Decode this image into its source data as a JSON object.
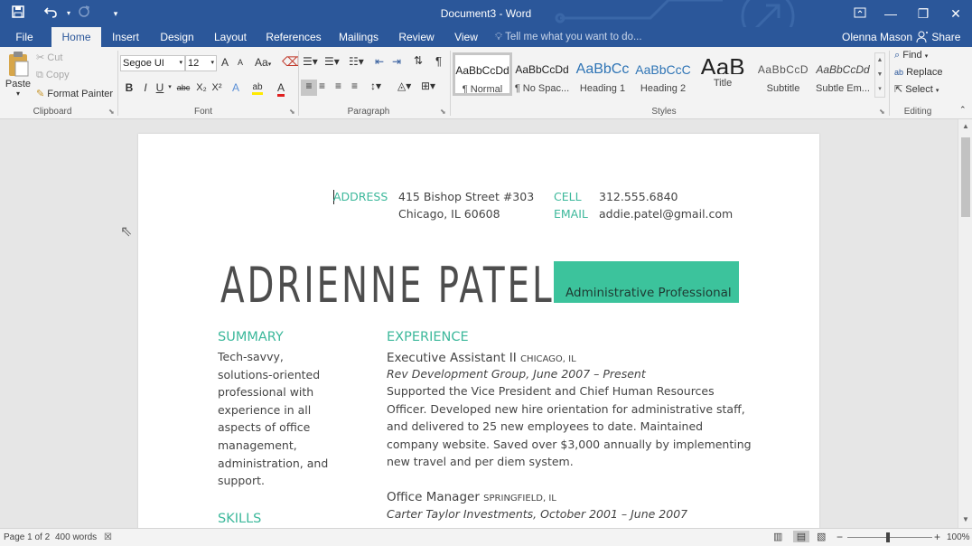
{
  "titlebar": {
    "title": "Document3 - Word",
    "save_icon": "save-icon",
    "undo_icon": "undo-icon",
    "redo_icon": "redo-icon",
    "customize_icon": "customize-qat-icon",
    "ribbon_display_icon": "ribbon-display-options-icon",
    "minimize_glyph": "—",
    "restore_glyph": "❐",
    "close_glyph": "✕"
  },
  "tabs": [
    "File",
    "Home",
    "Insert",
    "Design",
    "Layout",
    "References",
    "Mailings",
    "Review",
    "View"
  ],
  "active_tab": "Home",
  "tell_me": "Tell me what you want to do...",
  "user": "Olenna Mason",
  "share": "Share",
  "clipboard": {
    "paste": "Paste",
    "cut": "Cut",
    "copy": "Copy",
    "format_painter": "Format Painter",
    "label": "Clipboard"
  },
  "font": {
    "family": "Segoe UI",
    "size": "12",
    "bold": "B",
    "italic": "I",
    "underline": "U",
    "strikethrough": "abc",
    "subscript": "X₂",
    "superscript": "X²",
    "grow": "A",
    "shrink": "A",
    "change_case": "Aa",
    "label": "Font"
  },
  "paragraph": {
    "label": "Paragraph"
  },
  "styles": {
    "label": "Styles",
    "items": [
      {
        "sample": "AaBbCcDd",
        "name": "¶ Normal"
      },
      {
        "sample": "AaBbCcDd",
        "name": "¶ No Spac..."
      },
      {
        "sample": "AaBbCc",
        "name": "Heading 1"
      },
      {
        "sample": "AaBbCcC",
        "name": "Heading 2"
      },
      {
        "sample": "AaB",
        "name": "Title"
      },
      {
        "sample": "AaBbCcD",
        "name": "Subtitle"
      },
      {
        "sample": "AaBbCcDd",
        "name": "Subtle Em..."
      }
    ]
  },
  "editing": {
    "label": "Editing",
    "find": "Find",
    "replace": "Replace",
    "select": "Select"
  },
  "resume": {
    "address_label": "ADDRESS",
    "address_line1": "415 Bishop Street #303",
    "address_line2": "Chicago, IL 60608",
    "cell_label": "CELL",
    "cell": "312.555.6840",
    "email_label": "EMAIL",
    "email": "addie.patel@gmail.com",
    "name": "ADRIENNE PATEL",
    "title": "Administrative Professional",
    "summary_heading": "SUMMARY",
    "summary": [
      "Tech-savvy,",
      "solutions-oriented",
      "professional with",
      "experience in all",
      "aspects of office",
      "management,",
      "administration, and",
      "support."
    ],
    "skills_heading": "SKILLS",
    "experience_heading": "EXPERIENCE",
    "job1_title": "Executive Assistant II",
    "job1_location": "CHICAGO, IL",
    "job1_org": "Rev Development Group, June 2007 – Present",
    "job1_desc": [
      "Supported the Vice President and Chief Human Resources",
      "Officer. Developed new hire orientation for administrative staff,",
      "and delivered to 25 new employees to date. Maintained",
      "company website. Saved over $3,000 annually by implementing",
      "new travel and per diem system."
    ],
    "job2_title": "Office Manager",
    "job2_location": "SPRINGFIELD, IL",
    "job2_org": "Carter Taylor Investments, October 2001 – June 2007"
  },
  "status": {
    "page": "Page 1 of 2",
    "words": "400 words",
    "zoom": "100%",
    "zoom_minus": "−",
    "zoom_plus": "+"
  }
}
